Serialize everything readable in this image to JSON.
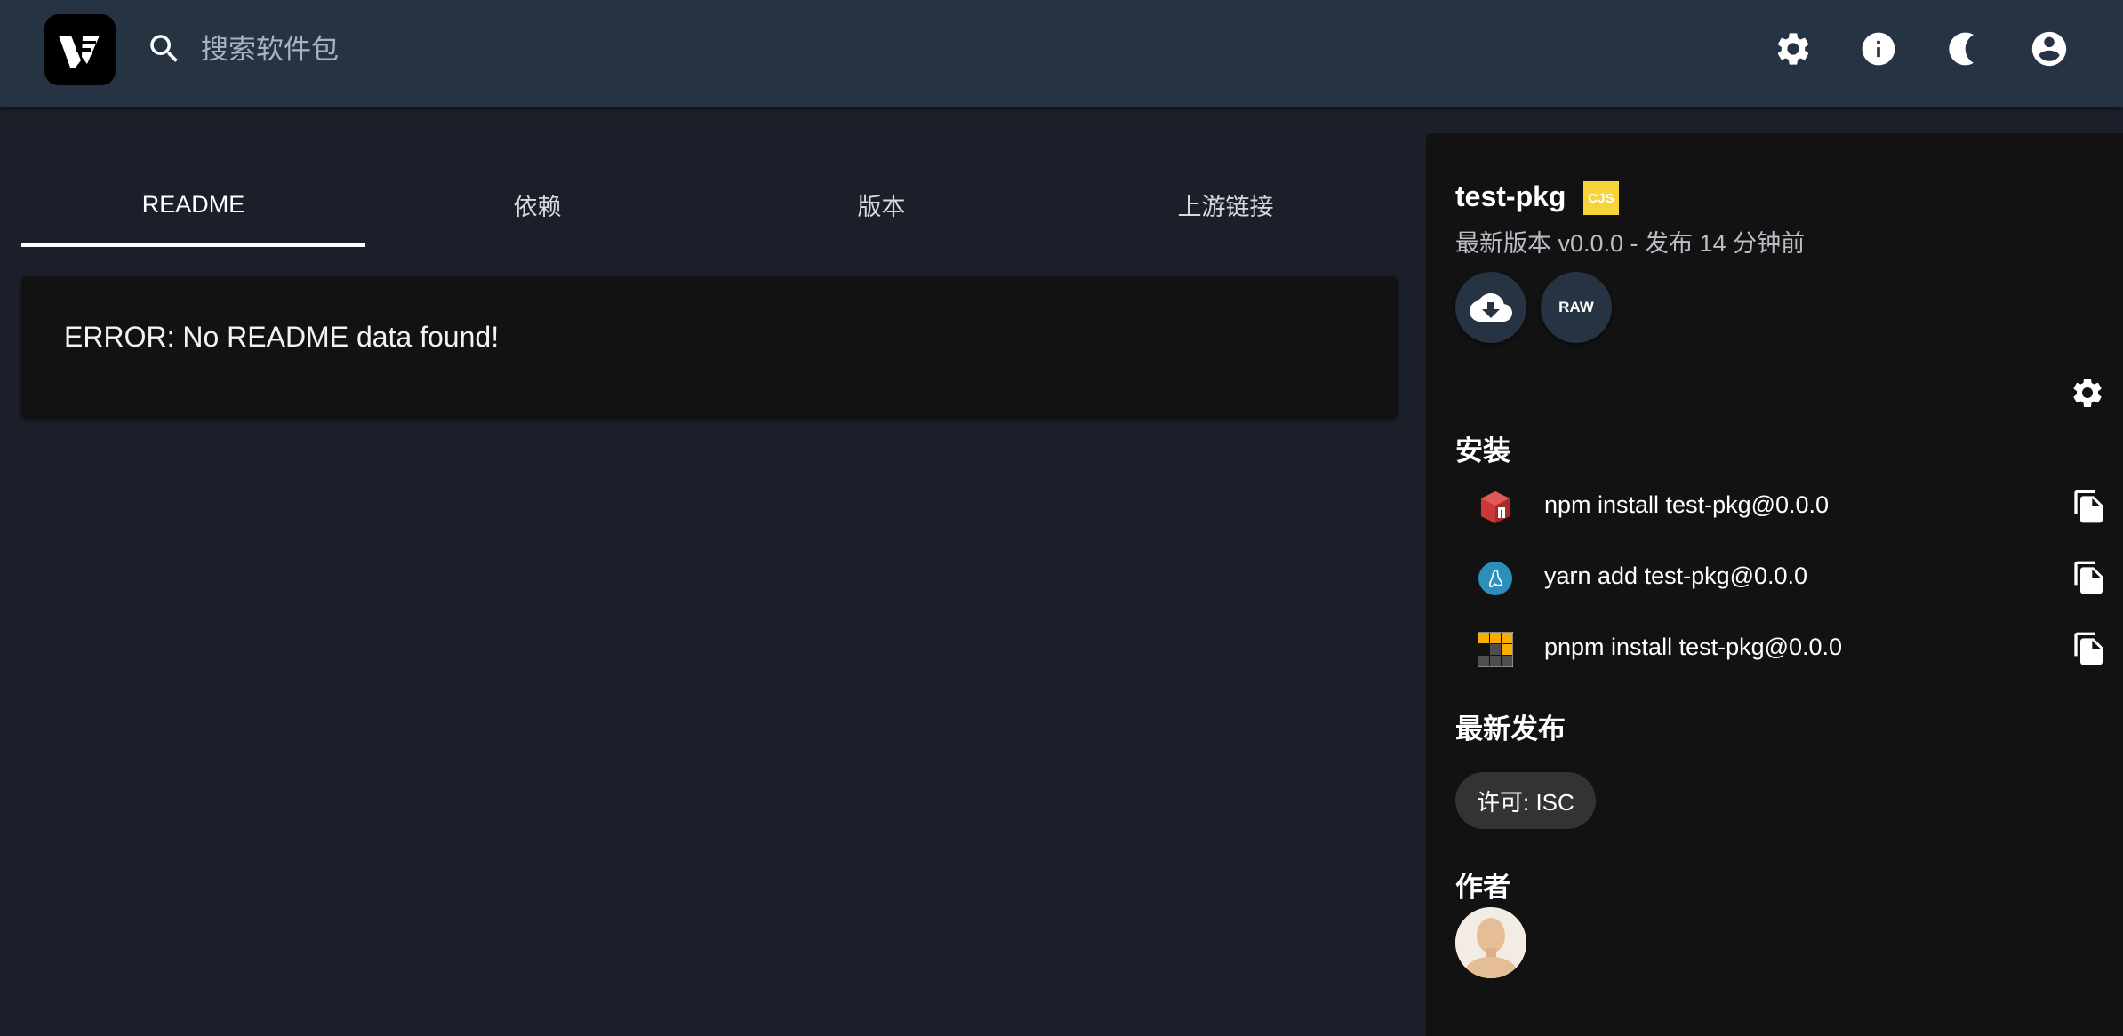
{
  "header": {
    "logo": "verdaccio-logo",
    "search_placeholder": "搜索软件包",
    "buttons": [
      "gear-icon",
      "info-icon",
      "moon-icon",
      "account-icon"
    ]
  },
  "tabs": [
    {
      "label": "README",
      "active": true
    },
    {
      "label": "依赖",
      "active": false
    },
    {
      "label": "版本",
      "active": false
    },
    {
      "label": "上游链接",
      "active": false
    }
  ],
  "readme": {
    "error": "ERROR: No README data found!"
  },
  "package": {
    "name": "test-pkg",
    "module_badge": "CJS",
    "subtitle": "最新版本 v0.0.0 - 发布 14 分钟前",
    "raw_label": "RAW"
  },
  "install": {
    "title": "安装",
    "commands": [
      {
        "manager": "npm",
        "command": "npm install test-pkg@0.0.0"
      },
      {
        "manager": "yarn",
        "command": "yarn add test-pkg@0.0.0"
      },
      {
        "manager": "pnpm",
        "command": "pnpm install test-pkg@0.0.0"
      }
    ]
  },
  "latest": {
    "title": "最新发布",
    "license": "许可: ISC"
  },
  "author": {
    "title": "作者"
  },
  "colors": {
    "header_bg": "#263342",
    "page_bg": "#1b1f29",
    "panel_bg": "#121212",
    "cjs_badge": "#f7d43a",
    "npm_red": "#cb3837",
    "yarn_blue": "#2c8ebb",
    "pnpm_orange": "#f9ad00"
  }
}
